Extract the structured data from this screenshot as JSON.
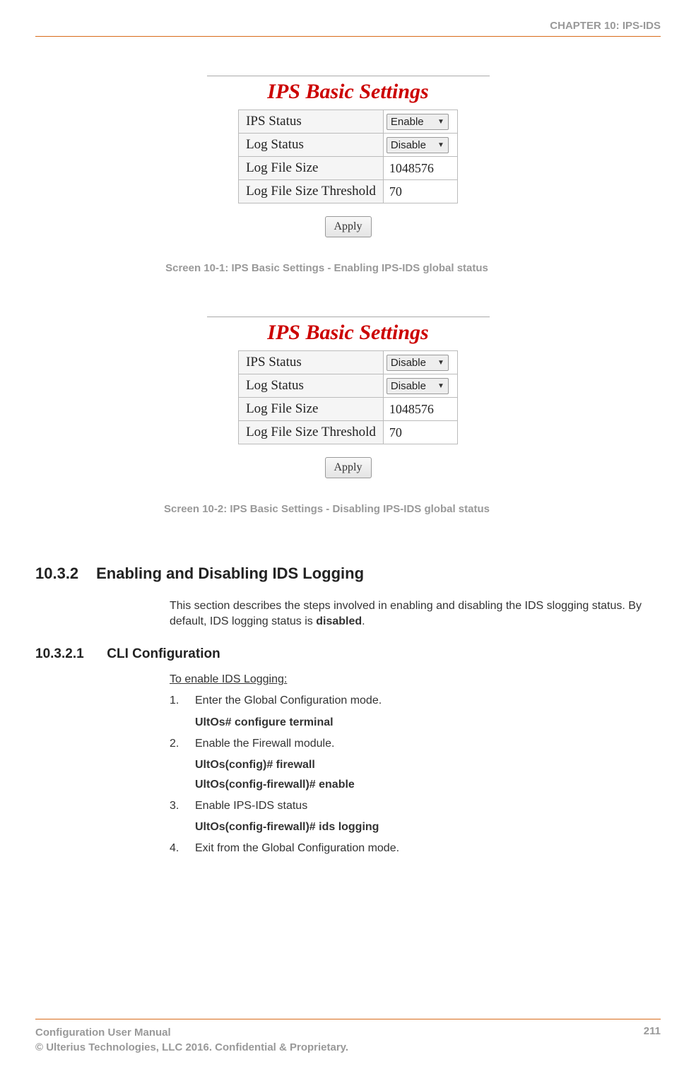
{
  "header": {
    "chapter": "CHAPTER 10: IPS-IDS"
  },
  "figure1": {
    "title": "IPS Basic Settings",
    "rows": {
      "ips_status": {
        "label": "IPS Status",
        "value": "Enable"
      },
      "log_status": {
        "label": "Log Status",
        "value": "Disable"
      },
      "log_file_size": {
        "label": "Log File Size",
        "value": "1048576"
      },
      "log_threshold": {
        "label": "Log File Size Threshold",
        "value": "70"
      }
    },
    "apply_label": "Apply",
    "caption": "Screen 10-1: IPS Basic Settings - Enabling IPS-IDS global status"
  },
  "figure2": {
    "title": "IPS Basic Settings",
    "rows": {
      "ips_status": {
        "label": "IPS Status",
        "value": "Disable"
      },
      "log_status": {
        "label": "Log Status",
        "value": "Disable"
      },
      "log_file_size": {
        "label": "Log File Size",
        "value": "1048576"
      },
      "log_threshold": {
        "label": "Log File Size Threshold",
        "value": "70"
      }
    },
    "apply_label": "Apply",
    "caption": "Screen 10-2: IPS Basic Settings - Disabling IPS-IDS global status"
  },
  "section": {
    "number": "10.3.2",
    "title": "Enabling and Disabling IDS Logging",
    "intro_prefix": "This section describes the steps involved in enabling and disabling the IDS slogging status. By default, IDS logging status is ",
    "intro_bold": "disabled",
    "intro_suffix": "."
  },
  "subsection": {
    "number": "10.3.2.1",
    "title": "CLI Configuration",
    "intro": "To enable IDS Logging:",
    "steps": {
      "s1": {
        "num": "1.",
        "text": "Enter the Global Configuration mode.",
        "cmd1": "UltOs# configure terminal"
      },
      "s2": {
        "num": "2.",
        "text": "Enable the Firewall module.",
        "cmd1": "UltOs(config)# firewall",
        "cmd2": "UltOs(config-firewall)# enable"
      },
      "s3": {
        "num": "3.",
        "text": "Enable IPS-IDS status",
        "cmd1": "UltOs(config-firewall)# ids logging"
      },
      "s4": {
        "num": "4.",
        "text": "Exit from the Global Configuration mode."
      }
    }
  },
  "footer": {
    "manual": "Configuration User Manual",
    "copyright": "© Ulterius Technologies, LLC 2016. Confidential & Proprietary.",
    "page": "211"
  }
}
